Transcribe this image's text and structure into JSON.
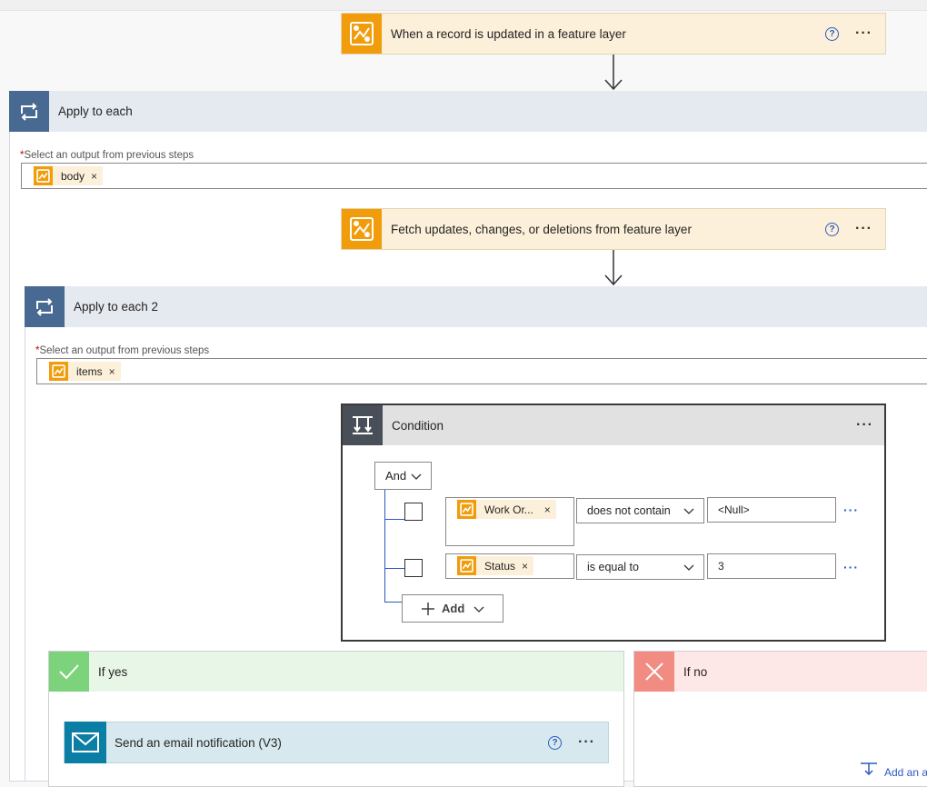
{
  "trigger": {
    "title": "When a record is updated in a feature layer",
    "help_glyph": "?",
    "more_glyph": "···"
  },
  "apply_each_1": {
    "title": "Apply to each",
    "field_label": "Select an output from previous steps",
    "required_mark": "*",
    "token": "body",
    "token_remove": "×"
  },
  "fetch": {
    "title": "Fetch updates, changes, or deletions from feature layer",
    "help_glyph": "?",
    "more_glyph": "···"
  },
  "apply_each_2": {
    "title": "Apply to each 2",
    "field_label": "Select an output from previous steps",
    "required_mark": "*",
    "token": "items",
    "token_remove": "×"
  },
  "condition": {
    "title": "Condition",
    "more_glyph": "···",
    "group_operator": "And",
    "rows": [
      {
        "token": "Work Or...",
        "token_remove": "×",
        "operator": "does not contain",
        "value": "<Null>",
        "more_glyph": "···"
      },
      {
        "token": "Status",
        "token_remove": "×",
        "operator": "is equal to",
        "value": "3",
        "more_glyph": "···"
      }
    ],
    "add_label": "Add"
  },
  "if_yes": {
    "title": "If yes"
  },
  "if_no": {
    "title": "If no",
    "add_action_partial": "Add an a"
  },
  "email": {
    "title": "Send an email notification (V3)",
    "help_glyph": "?",
    "more_glyph": "···"
  },
  "colors": {
    "arcgis_orange": "#f09c0b",
    "trigger_bg": "#fcf0da",
    "loop_blue": "#486991",
    "condition_dark": "#484f58",
    "yes_green": "#7cd37c",
    "no_red": "#f28b82",
    "email_teal": "#0a7ea4",
    "link_blue": "#2c59c3"
  }
}
